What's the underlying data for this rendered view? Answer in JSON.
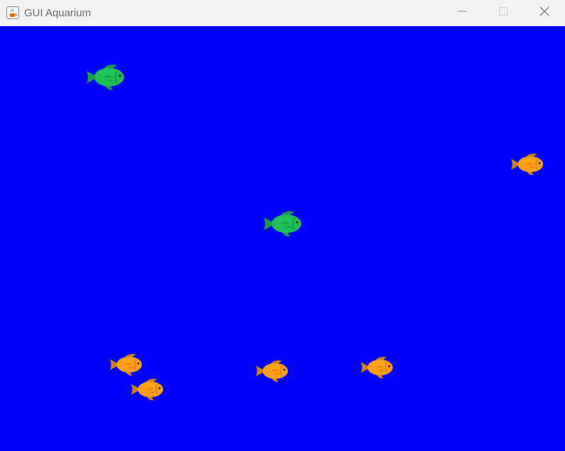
{
  "window": {
    "title": "GUI Aquarium",
    "app_icon": "java-cup-icon",
    "controls": {
      "minimize_icon": "minimize-icon",
      "maximize_icon": "maximize-icon",
      "close_icon": "close-icon"
    }
  },
  "aquarium": {
    "water_color": "#0000ff",
    "fish": [
      {
        "id": "fish-1",
        "species": "green",
        "color": "#1fbe57"
      },
      {
        "id": "fish-2",
        "species": "orange",
        "color": "#ff9d14"
      },
      {
        "id": "fish-3",
        "species": "green",
        "color": "#1fbe57"
      },
      {
        "id": "fish-4",
        "species": "orange",
        "color": "#ff9d14"
      },
      {
        "id": "fish-5",
        "species": "orange",
        "color": "#ff9d14"
      },
      {
        "id": "fish-6",
        "species": "orange",
        "color": "#ff9d14"
      },
      {
        "id": "fish-7",
        "species": "orange",
        "color": "#ff9d14"
      }
    ]
  }
}
